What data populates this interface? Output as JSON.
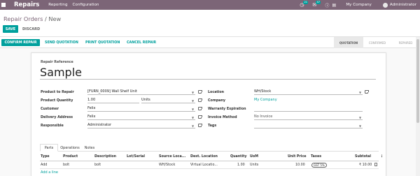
{
  "navbar": {
    "app_name": "Repairs",
    "menu": [
      "Reporting",
      "Configuration"
    ],
    "activity_count": "21",
    "messages_count": "47",
    "company": "My Company",
    "user": "Administrator",
    "accent": "#7c6577"
  },
  "breadcrumb": {
    "parent": "Repair Orders",
    "separator": "/",
    "current": "New"
  },
  "buttons": {
    "save": "SAVE",
    "discard": "DISCARD"
  },
  "statusbar": {
    "actions": [
      "CONFIRM REPAIR",
      "SEND QUOTATION",
      "PRINT QUOTATION",
      "CANCEL REPAIR"
    ],
    "states": [
      "QUOTATION",
      "CONFIRMED",
      "REPAIRED"
    ],
    "active_state": "QUOTATION"
  },
  "form": {
    "ref_label": "Repair Reference",
    "ref_value": "Sample",
    "left": [
      {
        "label": "Product to Repair",
        "value": "[FURN_0009] Wall Shelf Unit"
      },
      {
        "label": "Product Quantity",
        "value": "1.00",
        "unit": "Units"
      },
      {
        "label": "Customer",
        "value": "Felix"
      },
      {
        "label": "Delivery Address",
        "value": "Felix"
      },
      {
        "label": "Responsible",
        "value": "Administrator"
      }
    ],
    "right": [
      {
        "label": "Location",
        "value": "WH/Stock"
      },
      {
        "label": "Company",
        "value": "My Company"
      },
      {
        "label": "Warranty Expiration",
        "value": ""
      },
      {
        "label": "Invoice Method",
        "value": "No Invoice"
      },
      {
        "label": "Tags",
        "value": ""
      }
    ]
  },
  "notebook": {
    "tabs": [
      "Parts",
      "Operations",
      "Notes"
    ],
    "active_tab": "Parts",
    "columns": [
      "Type",
      "Product",
      "Description",
      "Lot/Serial",
      "Source Loca...",
      "Dest. Location",
      "Quantity",
      "UoM",
      "Unit Price",
      "Taxes",
      "Subtotal"
    ],
    "rows": [
      {
        "type": "Add",
        "product": "bolt",
        "description": "bolt",
        "lot": "",
        "source": "WH/Stock",
        "dest": "Virtual Locatio...",
        "quantity": "1.00",
        "uom": "Units",
        "unit_price": "10.00",
        "taxes": "GST 5%",
        "subtotal": "₹ 10.00"
      }
    ],
    "add_line": "Add a line"
  },
  "colors": {
    "primary": "#00a09d",
    "brand": "#7c6577"
  }
}
